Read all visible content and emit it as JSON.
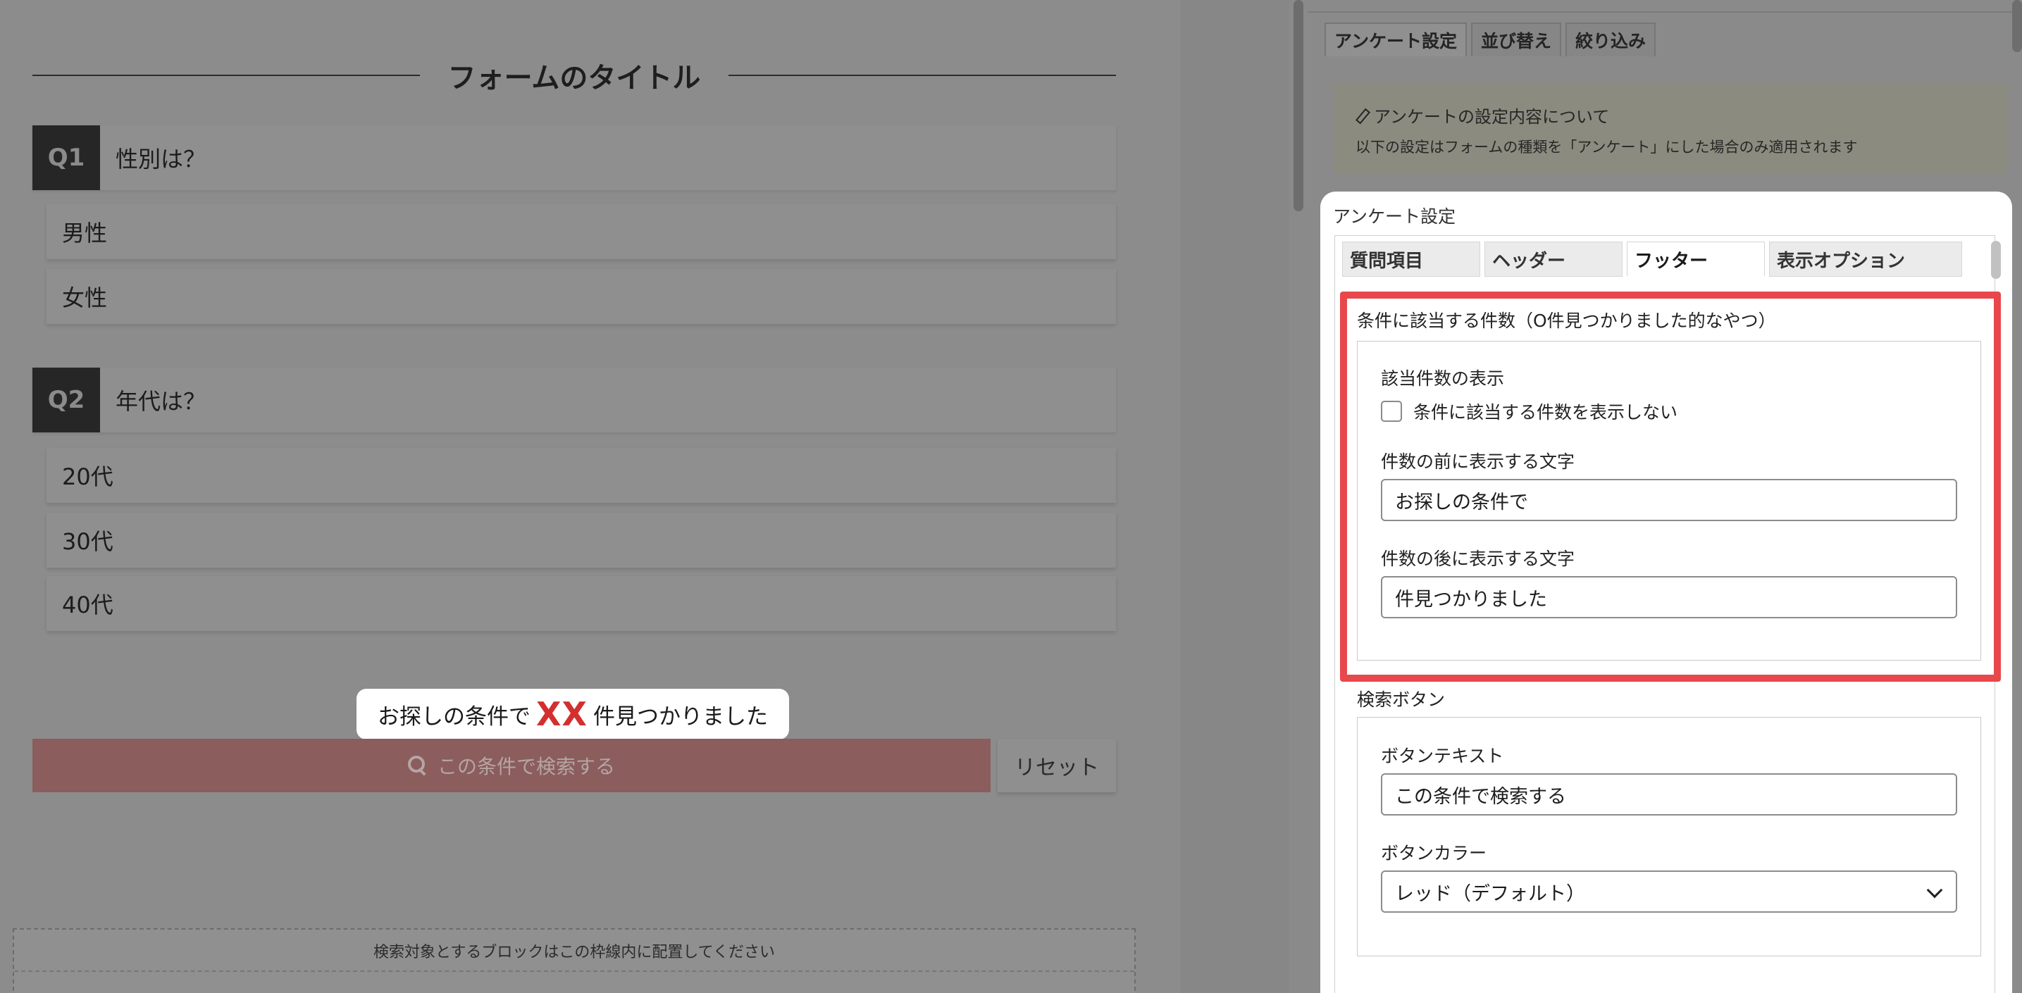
{
  "form": {
    "title": "フォームのタイトル",
    "questions": [
      {
        "badge": "Q1",
        "text": "性別は？",
        "options": [
          "男性",
          "女性"
        ]
      },
      {
        "badge": "Q2",
        "text": "年代は？",
        "options": [
          "20代",
          "30代",
          "40代"
        ]
      }
    ],
    "count_prefix": "お探しの条件で",
    "count_value": "XX",
    "count_suffix": "件見つかりました",
    "search_button": "この条件で検索する",
    "reset_button": "リセット",
    "drop_zone_label": "検索対象とするブロックはこの枠線内に配置してください"
  },
  "sidebar": {
    "tabs": [
      "アンケート設定",
      "並び替え",
      "絞り込み"
    ],
    "notice_title": "アンケートの設定内容について",
    "notice_desc": "以下の設定はフォームの種類を「アンケート」にした場合のみ適用されます",
    "panel_title": "アンケート設定",
    "panel_tabs": [
      "質問項目",
      "ヘッダー",
      "フッター",
      "表示オプション"
    ],
    "active_panel_tab": "フッター",
    "count_section": {
      "title": "条件に該当する件数（O件見つかりました的なやつ）",
      "display_label": "該当件数の表示",
      "hide_checkbox_label": "条件に該当する件数を表示しない",
      "hide_checked": false,
      "before_label": "件数の前に表示する文字",
      "before_value": "お探しの条件で",
      "after_label": "件数の後に表示する文字",
      "after_value": "件見つかりました"
    },
    "button_section": {
      "title": "検索ボタン",
      "text_label": "ボタンテキスト",
      "text_value": "この条件で検索する",
      "color_label": "ボタンカラー",
      "color_value": "レッド（デフォルト）"
    }
  },
  "colors": {
    "highlight": "#e8474c",
    "count_xx": "#d32f2f",
    "overlay": "#8c8c8c"
  }
}
